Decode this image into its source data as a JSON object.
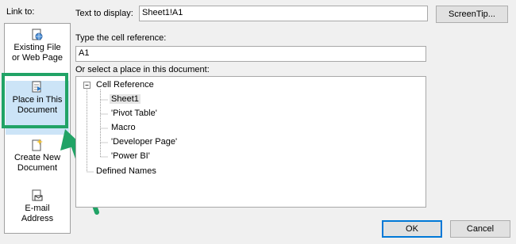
{
  "link_to": {
    "label": "Link to:",
    "items": [
      {
        "line1": "Existing File",
        "line2": "or Web Page",
        "icon": "globe-document-icon"
      },
      {
        "line1": "Place in This",
        "line2": "Document",
        "icon": "document-place-icon"
      },
      {
        "line1": "Create New",
        "line2": "Document",
        "icon": "new-document-icon"
      },
      {
        "line1": "E-mail",
        "line2": "Address",
        "icon": "email-document-icon"
      }
    ]
  },
  "text_to_display": {
    "label": "Text to display:",
    "value": "Sheet1!A1"
  },
  "screentip_button": "ScreenTip...",
  "cell_reference": {
    "label": "Type the cell reference:",
    "value": "A1"
  },
  "place_select": {
    "label": "Or select a place in this document:"
  },
  "tree": {
    "root": "Cell Reference",
    "expander": "⊟",
    "sheets": [
      "Sheet1",
      "'Pivot Table'",
      "Macro",
      "'Developer Page'",
      "'Power BI'"
    ],
    "selected": "Sheet1",
    "defined_names": "Defined Names"
  },
  "ok_button": "OK",
  "cancel_button": "Cancel",
  "colors": {
    "highlight": "#21a366",
    "arrow": "#21a366",
    "selected_bg": "#cce4f7"
  }
}
